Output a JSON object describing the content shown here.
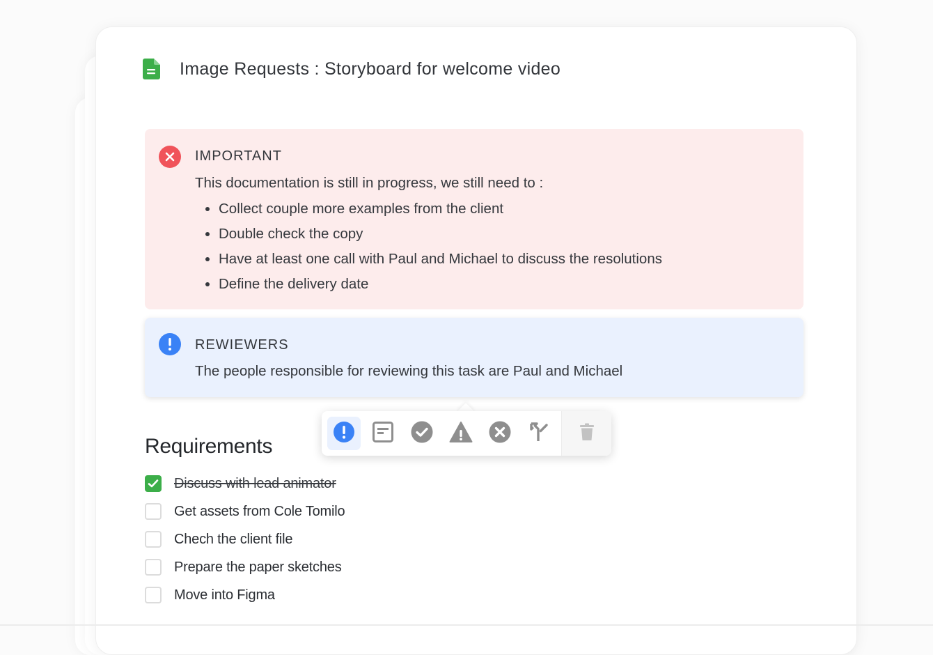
{
  "document": {
    "title": "Image Requests : Storyboard for welcome video",
    "icon": "document-icon",
    "icon_color": "#3cae49"
  },
  "important_callout": {
    "heading": "IMPORTANT",
    "icon": "close-circle-icon",
    "icon_color": "#f0535a",
    "background": "#fdecec",
    "intro": "This documentation is still in progress, we still need to :",
    "items": [
      "Collect couple more examples from the client",
      "Double check the copy",
      "Have at least one call with Paul and Michael to discuss the resolutions",
      "Define the delivery date"
    ]
  },
  "reviewers_callout": {
    "heading": "REWIEWERS",
    "icon": "exclamation-circle-icon",
    "icon_color": "#3a82f6",
    "background": "#eaf1fe",
    "text": "The people responsible for reviewing this task are Paul and Michael"
  },
  "toolbar": {
    "buttons": [
      {
        "icon": "info-exclamation-icon",
        "active": true
      },
      {
        "icon": "note-icon",
        "active": false
      },
      {
        "icon": "check-circle-icon",
        "active": false
      },
      {
        "icon": "warning-triangle-icon",
        "active": false
      },
      {
        "icon": "error-circle-icon",
        "active": false
      },
      {
        "icon": "merge-arrow-icon",
        "active": false
      },
      {
        "icon": "trash-icon",
        "active": false
      }
    ]
  },
  "requirements": {
    "heading": "Requirements",
    "items": [
      {
        "label": "Discuss with lead animator",
        "checked": true
      },
      {
        "label": "Get assets from Cole Tomilo",
        "checked": false
      },
      {
        "label": "Chech the client file",
        "checked": false
      },
      {
        "label": "Prepare the paper sketches",
        "checked": false
      },
      {
        "label": "Move into Figma",
        "checked": false
      }
    ]
  }
}
